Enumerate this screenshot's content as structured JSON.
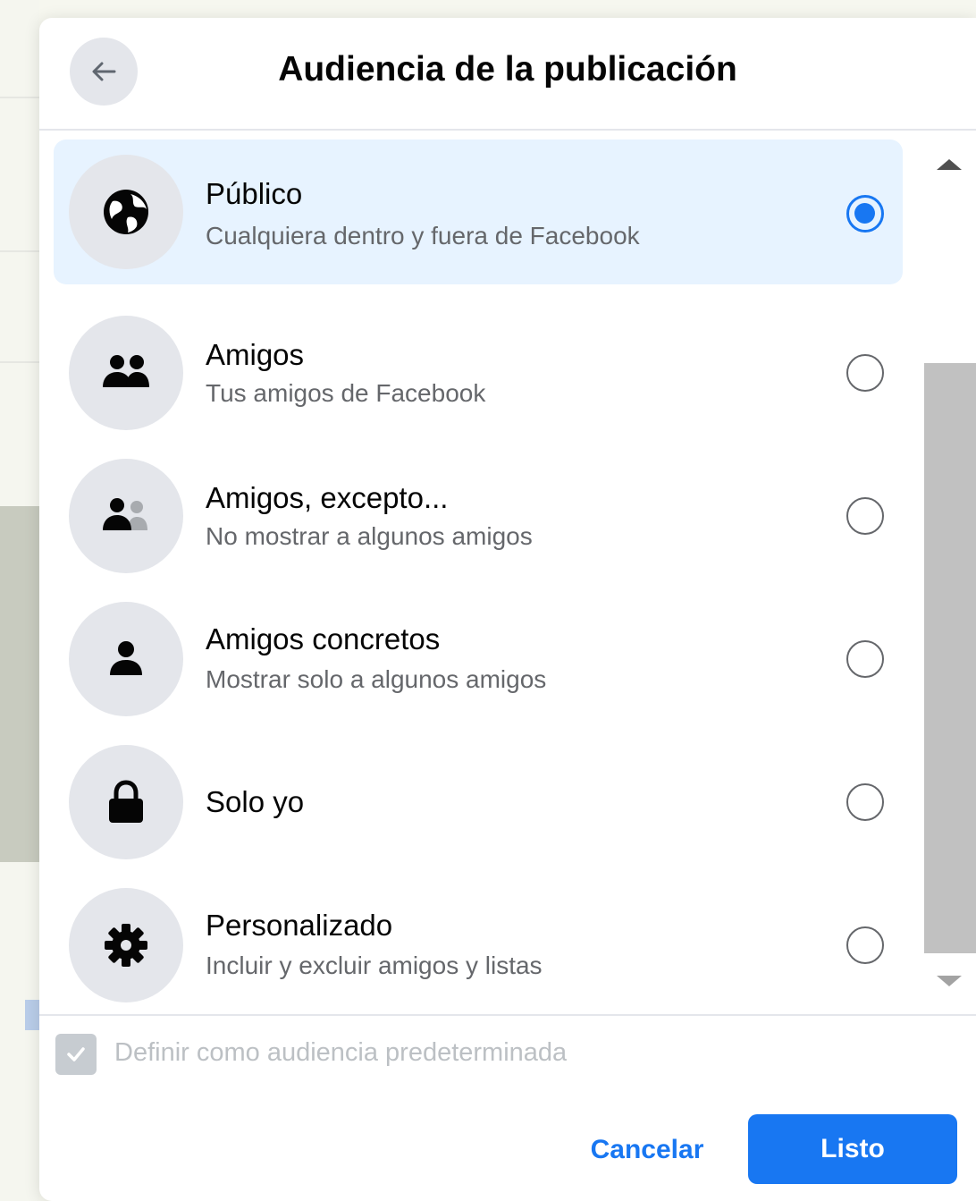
{
  "dialog": {
    "title": "Audiencia de la publicación"
  },
  "options": [
    {
      "label": "Público",
      "description": "Cualquiera dentro y fuera de Facebook",
      "icon": "globe-icon",
      "selected": true
    },
    {
      "label": "Amigos",
      "description": "Tus amigos de Facebook",
      "icon": "friends-icon",
      "selected": false
    },
    {
      "label": "Amigos, excepto...",
      "description": "No mostrar a algunos amigos",
      "icon": "friends-except-icon",
      "selected": false
    },
    {
      "label": "Amigos concretos",
      "description": "Mostrar solo a algunos amigos",
      "icon": "person-icon",
      "selected": false
    },
    {
      "label": "Solo yo",
      "description": "",
      "icon": "lock-icon",
      "selected": false
    },
    {
      "label": "Personalizado",
      "description": "Incluir y excluir amigos y listas",
      "icon": "gear-icon",
      "selected": false
    }
  ],
  "default_audience": {
    "label": "Definir como audiencia predeterminada",
    "checked": true,
    "disabled": true
  },
  "footer": {
    "cancel_label": "Cancelar",
    "done_label": "Listo"
  },
  "colors": {
    "accent": "#1877f2",
    "selected_bg": "#e7f3ff",
    "icon_bg": "#e4e6eb"
  }
}
